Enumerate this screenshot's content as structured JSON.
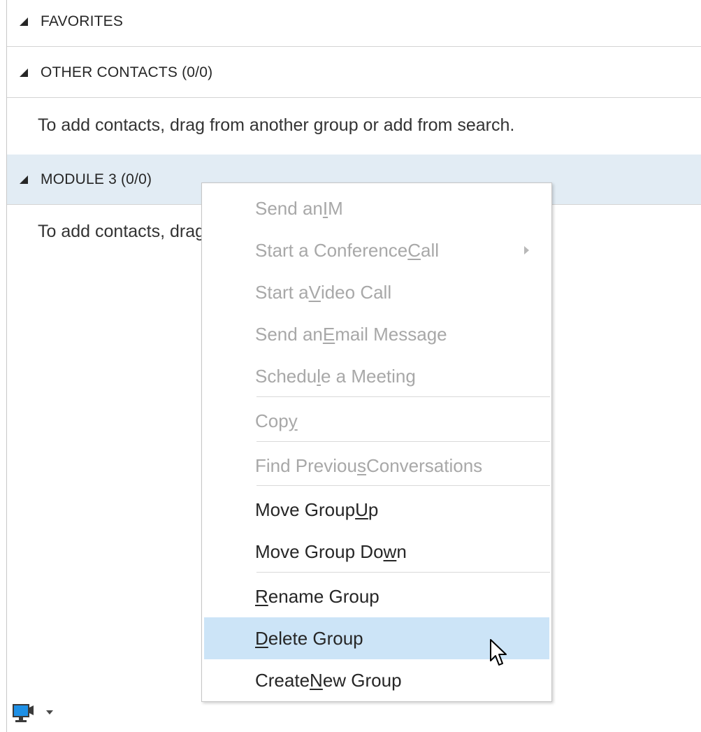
{
  "groups": [
    {
      "name": "FAVORITES"
    },
    {
      "name": "OTHER CONTACTS (0/0)",
      "hint": "To add contacts, drag from another group or add from search."
    },
    {
      "name": "MODULE 3 (0/0)",
      "hint": "To add contacts, drag from another group or add from search.",
      "selected": true
    }
  ],
  "context_menu": {
    "items": [
      {
        "pre": "Send an ",
        "key": "I",
        "post": "M",
        "enabled": false
      },
      {
        "pre": "Start a Conference ",
        "key": "C",
        "post": "all",
        "enabled": false,
        "submenu": true
      },
      {
        "pre": "Start a ",
        "key": "V",
        "post": "ideo Call",
        "enabled": false
      },
      {
        "pre": "Send an ",
        "key": "E",
        "post": "mail Message",
        "enabled": false
      },
      {
        "pre": "Schedu",
        "key": "l",
        "post": "e a Meeting",
        "enabled": false
      },
      {
        "pre": "Cop",
        "key": "y",
        "post": "",
        "enabled": false
      },
      {
        "pre": "Find Previou",
        "key": "s",
        "post": " Conversations",
        "enabled": false
      },
      {
        "pre": "Move Group ",
        "key": "U",
        "post": "p",
        "enabled": true
      },
      {
        "pre": "Move Group Do",
        "key": "w",
        "post": "n",
        "enabled": true
      },
      {
        "pre": "",
        "key": "R",
        "post": "ename Group",
        "enabled": true
      },
      {
        "pre": "",
        "key": "D",
        "post": "elete Group",
        "enabled": true,
        "highlighted": true
      },
      {
        "pre": "Create ",
        "key": "N",
        "post": "ew Group",
        "enabled": true
      }
    ]
  },
  "status_bar": {
    "icon": "presenting-monitor-icon",
    "dropdown_icon": "caret-down-icon"
  },
  "colors": {
    "selection": "#e2ecf4",
    "menu_highlight": "#cce4f7",
    "disabled_text": "#a8a8a8",
    "text": "#262626",
    "icon_blue": "#1e90e6"
  }
}
